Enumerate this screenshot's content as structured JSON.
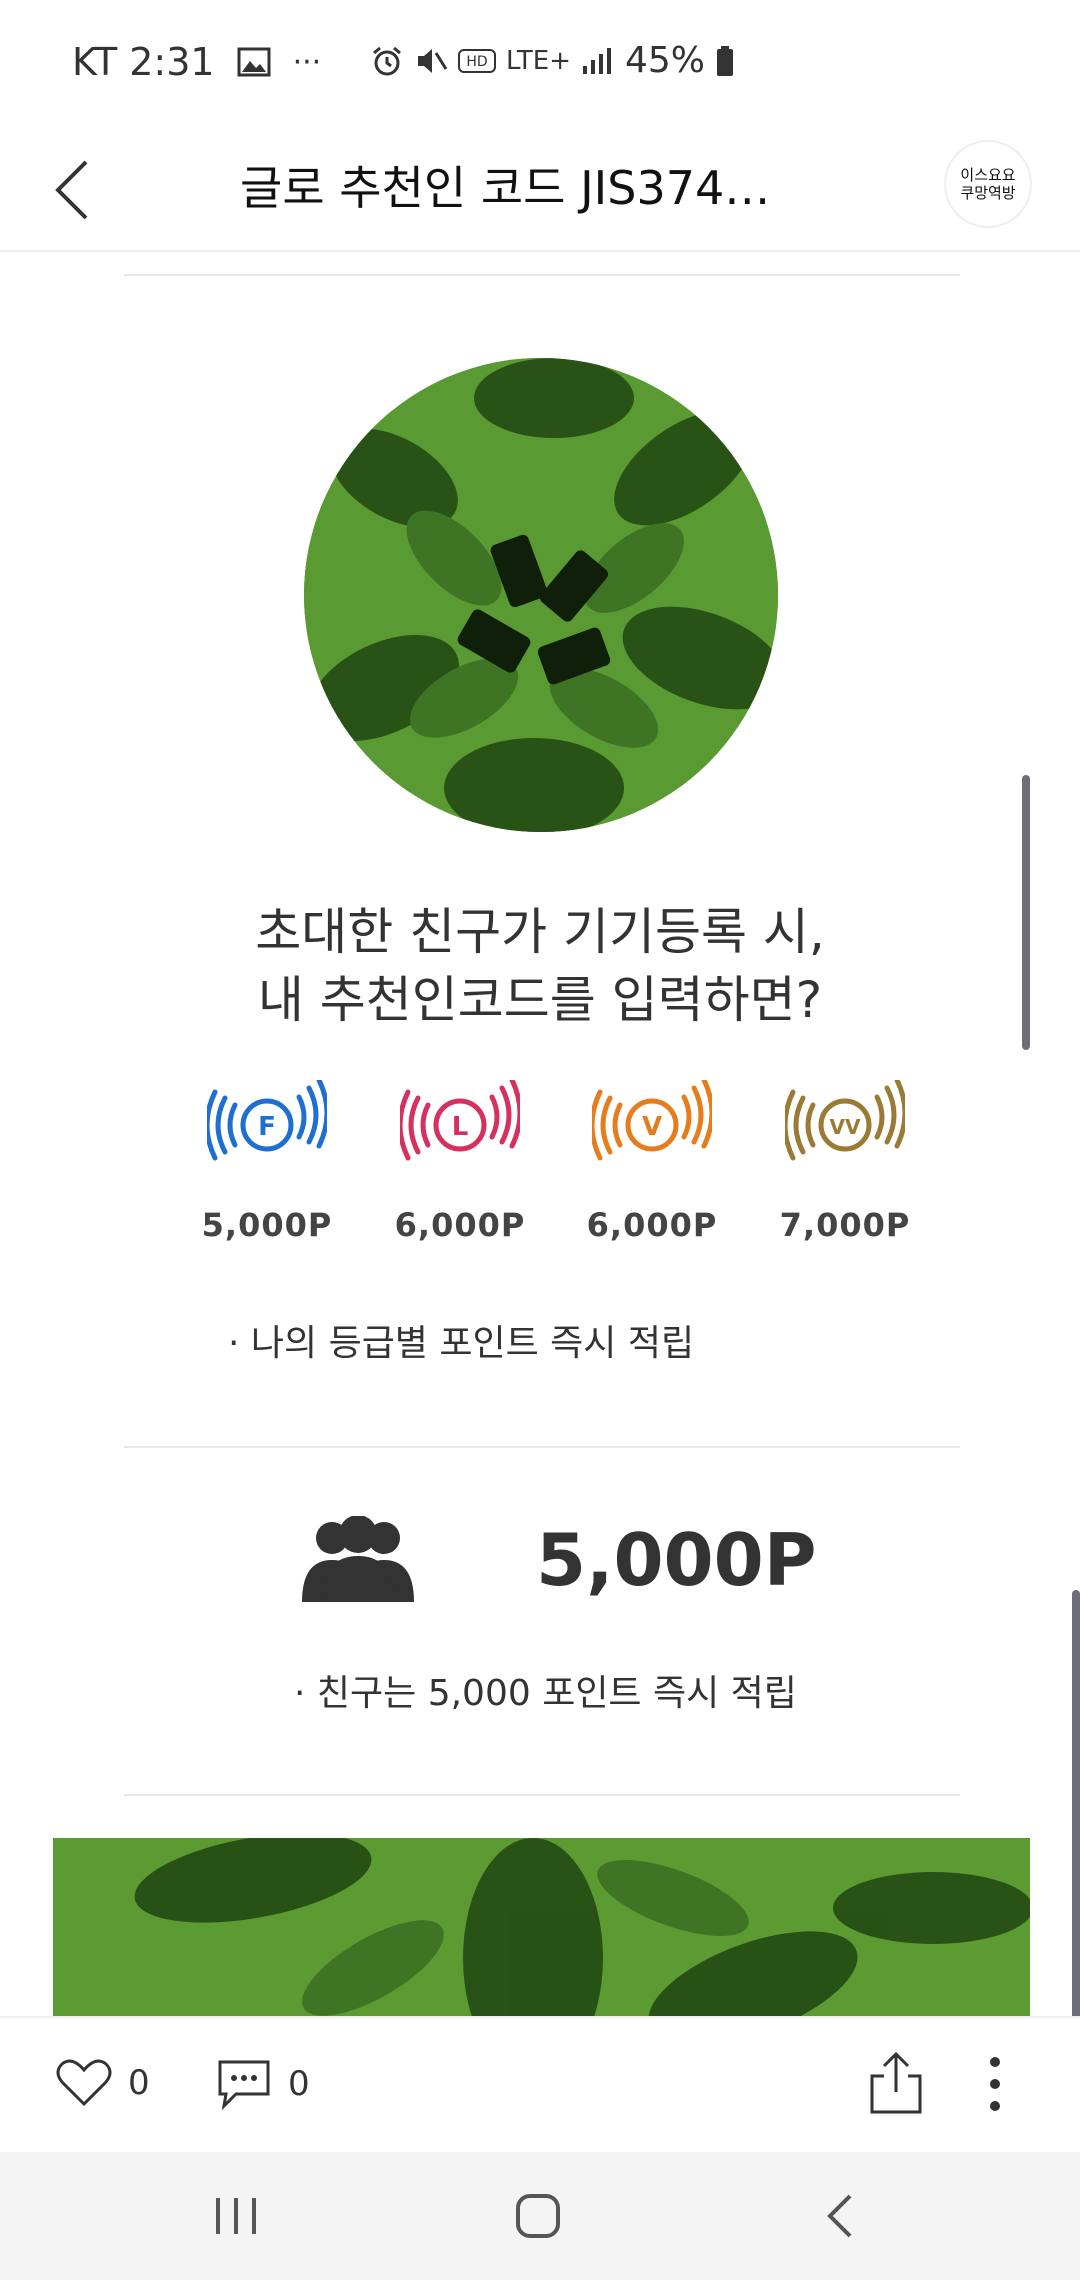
{
  "status": {
    "carrier_time": "KT 2:31",
    "dots": "···",
    "net_badge": "LTE+",
    "battery": "45%"
  },
  "header": {
    "title": "글로 추천인 코드 JIS374…",
    "avatar_text": "이스요요\n쿠망역방"
  },
  "content": {
    "headline_line1": "초대한 친구가 기기등록 시,",
    "headline_line2": "내 추천인코드를 입력하면?",
    "grades": [
      {
        "letter": "F",
        "points": "5,000P",
        "color": "#1f6fd1"
      },
      {
        "letter": "L",
        "points": "6,000P",
        "color": "#d6305e"
      },
      {
        "letter": "V",
        "points": "6,000P",
        "color": "#e57d1f"
      },
      {
        "letter": "VV",
        "points": "7,000P",
        "color": "#9a7a34"
      }
    ],
    "grade_note": "· 나의 등급별 포인트 즉시 적립",
    "friend_points": "5,000P",
    "friend_note": "· 친구는 5,000 포인트 즉시 적립"
  },
  "actions": {
    "like_count": "0",
    "comment_count": "0"
  },
  "colors": {
    "hero_green": "#5a9a32",
    "dark_green": "#1f3d12"
  }
}
